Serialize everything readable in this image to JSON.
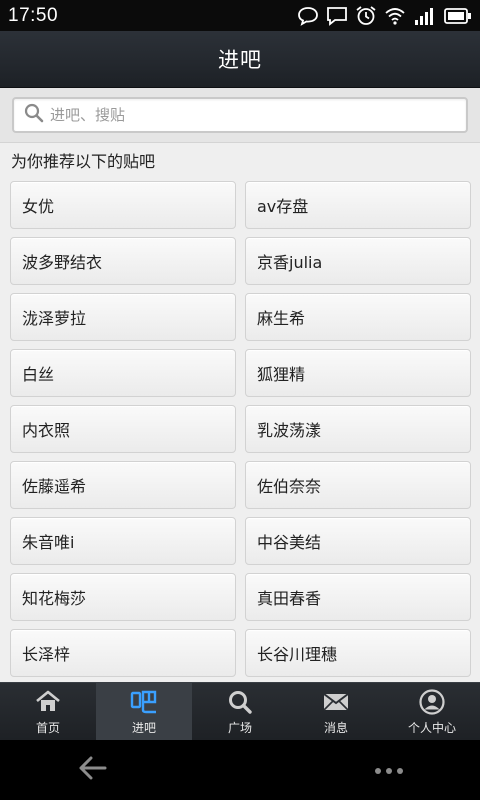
{
  "status_bar": {
    "time": "17:50",
    "icons": [
      "chat-bubble-icon",
      "message-icon",
      "alarm-icon",
      "wifi-icon",
      "signal-icon",
      "battery-icon"
    ]
  },
  "title_bar": {
    "title": "进吧"
  },
  "search": {
    "placeholder": "进吧、搜贴",
    "value": ""
  },
  "recommend": {
    "heading": "为你推荐以下的贴吧",
    "items": [
      "女优",
      "av存盘",
      "波多野结衣",
      "京香julia",
      "泷泽萝拉",
      "麻生希",
      "白丝",
      "狐狸精",
      "内衣照",
      "乳波荡漾",
      "佐藤遥希",
      "佐伯奈奈",
      "朱音唯i",
      "中谷美结",
      "知花梅莎",
      "真田春香",
      "长泽梓",
      "长谷川理穗"
    ]
  },
  "tab_bar": {
    "active_index": 1,
    "tabs": [
      {
        "label": "首页",
        "icon": "home-icon"
      },
      {
        "label": "进吧",
        "icon": "ba-icon"
      },
      {
        "label": "广场",
        "icon": "search-icon"
      },
      {
        "label": "消息",
        "icon": "mail-icon"
      },
      {
        "label": "个人中心",
        "icon": "profile-icon"
      }
    ]
  },
  "nav_bar": {
    "icons": [
      "back-arrow-icon",
      "more-dots-icon"
    ]
  },
  "colors": {
    "header_bg": "#23272c",
    "tab_active_bg": "#3a3f45",
    "content_bg": "#efefef"
  }
}
